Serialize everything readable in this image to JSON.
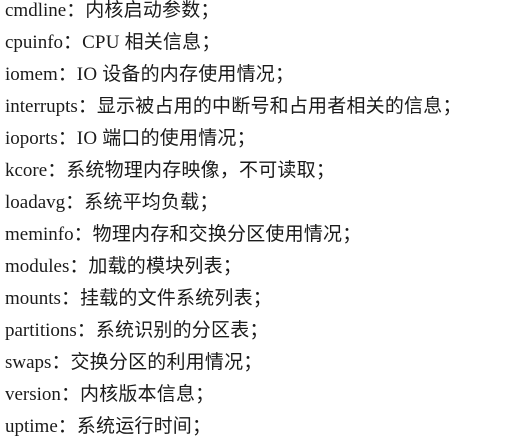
{
  "entries": [
    {
      "name": "cmdline",
      "sep": "：",
      "desc": "内核启动参数；"
    },
    {
      "name": "cpuinfo",
      "sep": "：",
      "desc": "CPU 相关信息；"
    },
    {
      "name": "iomem",
      "sep": "：",
      "desc": "IO 设备的内存使用情况；"
    },
    {
      "name": "interrupts",
      "sep": "：",
      "desc": "显示被占用的中断号和占用者相关的信息；"
    },
    {
      "name": "ioports",
      "sep": "：",
      "desc": "IO 端口的使用情况；"
    },
    {
      "name": "kcore",
      "sep": "：",
      "desc": "系统物理内存映像，不可读取；"
    },
    {
      "name": "loadavg",
      "sep": "：",
      "desc": "系统平均负载；"
    },
    {
      "name": "meminfo",
      "sep": "：",
      "desc": "物理内存和交换分区使用情况；"
    },
    {
      "name": "modules",
      "sep": "：",
      "desc": "加载的模块列表；"
    },
    {
      "name": "mounts",
      "sep": "：",
      "desc": "挂载的文件系统列表；"
    },
    {
      "name": "partitions",
      "sep": "：",
      "desc": "系统识别的分区表；"
    },
    {
      "name": "swaps",
      "sep": "：",
      "desc": "交换分区的利用情况；"
    },
    {
      "name": "version",
      "sep": "：",
      "desc": "内核版本信息；"
    },
    {
      "name": "uptime",
      "sep": "：",
      "desc": "系统运行时间；"
    }
  ]
}
